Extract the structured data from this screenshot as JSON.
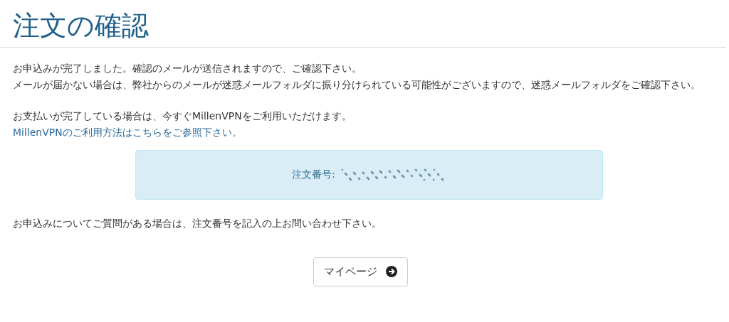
{
  "title": "注文の確認",
  "messages": [
    "お申込みが完了しました。確認のメールが送信されますので、ご確認下さい。",
    "メールが届かない場合は、弊社からのメールが迷惑メールフォルダに振り分けられている可能性がございますので、迷惑メールフォルダをご確認下さい。"
  ],
  "payment_message": "お支払いが完了している場合は、今すぐMillenVPNをご利用いただけます。",
  "usage_link": "MillenVPNのご利用方法はこちらをご参照下さい。",
  "order_box": {
    "label": "注文番号:"
  },
  "inquiry_message": "お申込みについてご質問がある場合は、注文番号を記入の上お問い合わせ下さい。",
  "mypage_button": {
    "label": "マイページ"
  }
}
